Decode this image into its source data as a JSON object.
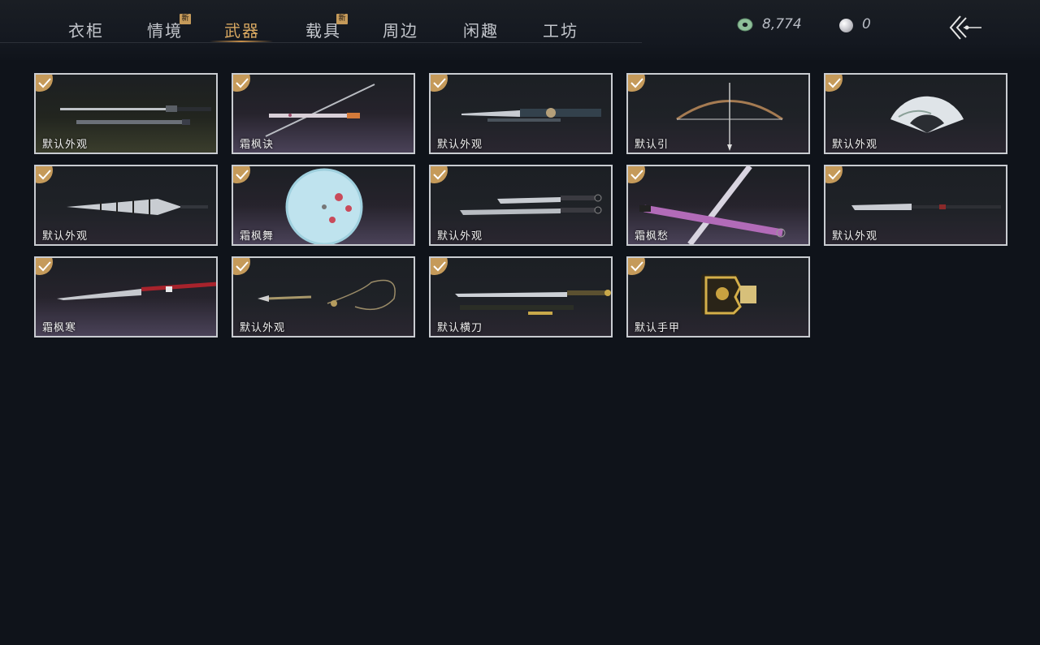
{
  "tabs": [
    {
      "label": "衣柜",
      "new": false,
      "active": false
    },
    {
      "label": "情境",
      "new": true,
      "active": false
    },
    {
      "label": "武器",
      "new": false,
      "active": true
    },
    {
      "label": "载具",
      "new": true,
      "active": false
    },
    {
      "label": "周边",
      "new": false,
      "active": false
    },
    {
      "label": "闲趣",
      "new": false,
      "active": false
    },
    {
      "label": "工坊",
      "new": false,
      "active": false
    }
  ],
  "badge_text": "新",
  "currency": {
    "jade": "8,774",
    "pearl": "0"
  },
  "items": [
    {
      "label": "默认外观",
      "icon": "twin-sword-icon",
      "equipped": true
    },
    {
      "label": "霜枫诀",
      "icon": "spear-icon",
      "equipped": true
    },
    {
      "label": "默认外观",
      "icon": "ornate-blade-icon",
      "equipped": true
    },
    {
      "label": "默认引",
      "icon": "bow-icon",
      "equipped": true
    },
    {
      "label": "默认外观",
      "icon": "folding-fan-icon",
      "equipped": true
    },
    {
      "label": "默认外观",
      "icon": "closed-umbrella-icon",
      "equipped": true
    },
    {
      "label": "霜枫舞",
      "icon": "parasol-icon",
      "equipped": true
    },
    {
      "label": "默认外观",
      "icon": "dual-dao-icon",
      "equipped": true
    },
    {
      "label": "霜枫愁",
      "icon": "crossed-blades-icon",
      "equipped": true
    },
    {
      "label": "默认外观",
      "icon": "long-glaive-icon",
      "equipped": true
    },
    {
      "label": "霜枫寒",
      "icon": "red-glaive-icon",
      "equipped": true
    },
    {
      "label": "默认外观",
      "icon": "rope-dart-icon",
      "equipped": true
    },
    {
      "label": "默认横刀",
      "icon": "hengdao-icon",
      "equipped": true
    },
    {
      "label": "默认手甲",
      "icon": "gauntlet-icon",
      "equipped": true
    }
  ],
  "colors": {
    "accent": "#d8a861",
    "check": "#c59a5a",
    "border": "#c9ccd1",
    "background": "#0f131a"
  }
}
